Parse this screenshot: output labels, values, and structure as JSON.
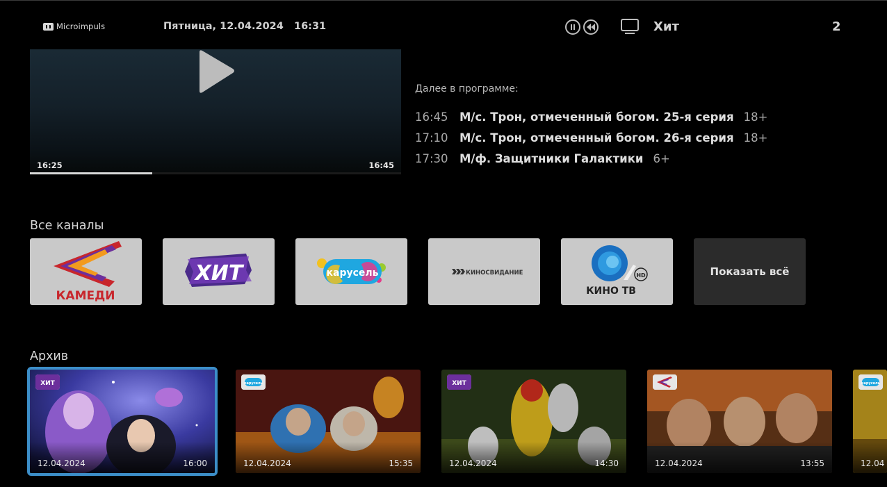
{
  "header": {
    "logo_text": "Microimpuls",
    "datetime": "Пятница, 12.04.2024   16:31",
    "channel_name": "Хит",
    "channel_number": "2",
    "icons": [
      "pause-icon",
      "rewind-icon",
      "tv-icon"
    ]
  },
  "player": {
    "start_time": "16:25",
    "end_time": "16:45",
    "progress_fraction": 0.33
  },
  "schedule": {
    "title": "Далее в программе:",
    "items": [
      {
        "time": "16:45",
        "name": "М/с. Трон, отмеченный богом. 25-я серия",
        "age": "18+"
      },
      {
        "time": "17:10",
        "name": "М/с. Трон, отмеченный богом. 26-я серия",
        "age": "18+"
      },
      {
        "time": "17:30",
        "name": "М/ф. Защитники Галактики",
        "age": "6+"
      }
    ]
  },
  "channels": {
    "title": "Все каналы",
    "items": [
      {
        "logo_label": "КАМЕДИ"
      },
      {
        "logo_label": "ХИТ"
      },
      {
        "logo_label": "карусель"
      },
      {
        "logo_label": "КИНОСВИДАНИЕ"
      },
      {
        "logo_label": "КИНО ТВ",
        "badge": "HD"
      }
    ],
    "show_all_label": "Показать всё"
  },
  "archive": {
    "title": "Архив",
    "items": [
      {
        "date": "12.04.2024",
        "time": "16:00",
        "channel_badge": "ХИТ"
      },
      {
        "date": "12.04.2024",
        "time": "15:35",
        "channel_badge": "карусель"
      },
      {
        "date": "12.04.2024",
        "time": "14:30",
        "channel_badge": "ХИТ"
      },
      {
        "date": "12.04.2024",
        "time": "13:55",
        "channel_badge": "КАМЕДИ"
      },
      {
        "date": "12.04",
        "time": "",
        "channel_badge": "карусель"
      }
    ]
  },
  "colors": {
    "background": "#000000",
    "selection": "#3c8ec8",
    "tile": "#c9c9c9",
    "kamedi_red": "#c8262c",
    "hit_purple": "#6c2f9c",
    "karusel_orange": "#f29a1e"
  }
}
